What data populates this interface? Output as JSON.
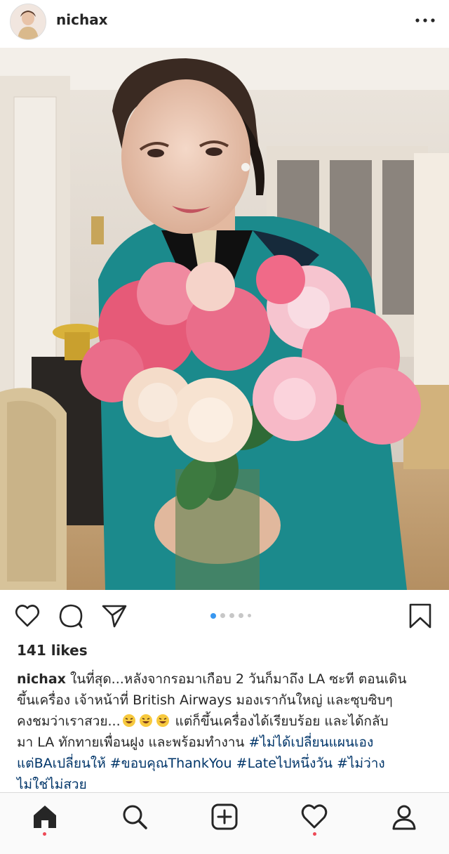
{
  "header": {
    "username": "nichax"
  },
  "post": {
    "likes": "141 likes",
    "carousel": {
      "count": 5,
      "active_index": 0
    },
    "caption": {
      "author": "nichax",
      "line1": "ในที่สุด...หลังจากรอมาเกือบ 2 วันก็มาถึง LA ซะที ตอนเดิน",
      "line2": "ขึ้นเครื่อง เจ้าหน้าที่ British Airways มองเรากันใหญ่ และซุบซิบๆ",
      "line3_a": "คงชมว่าเราสวย...",
      "line3_b": " แต่ก็ขึ้นเครื่องได้เรียบร้อย และได้กลับ",
      "line4_a": "มา LA ทักทายเพื่อนฝูง และพร้อมทำงาน ",
      "tag1": "#ไม่ได้เปลี่ยนแผนเอง",
      "tag1_b": "แต่BAเปลี่ยนให้",
      "tag2": "#ขอบคุณThankYou",
      "tag3": "#Lateไปหนึ่งวัน",
      "tag4": "#ไม่ว่าง",
      "tag4_b": "ไม่ใช่ไม่สวย"
    }
  },
  "icons": {
    "more": "more-horizontal-icon",
    "like": "heart-outline-icon",
    "comment": "comment-bubble-icon",
    "share": "paper-plane-icon",
    "save": "bookmark-icon",
    "emoji": "rolling-laughing-emoji"
  },
  "nav": [
    "home-icon",
    "search-icon",
    "new-post-icon",
    "activity-heart-icon",
    "profile-icon"
  ],
  "colors": {
    "hashtag": "#003569",
    "active_dot": "#3897f0",
    "notification": "#ed4956"
  }
}
